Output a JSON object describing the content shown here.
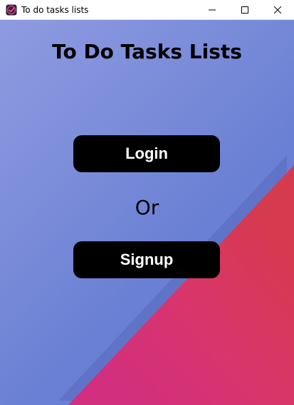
{
  "window": {
    "title": "To do tasks lists",
    "controls": {
      "minimize": "minimize-icon",
      "maximize": "maximize-icon",
      "close": "close-icon"
    }
  },
  "main": {
    "heading": "To Do Tasks Lists",
    "login_label": "Login",
    "or_label": "Or",
    "signup_label": "Signup"
  },
  "colors": {
    "background_blue": "#7a8cd9",
    "corner_red": "#d63a4e",
    "corner_pink": "#d6307c",
    "button_bg": "#000000",
    "button_text": "#ffffff"
  }
}
